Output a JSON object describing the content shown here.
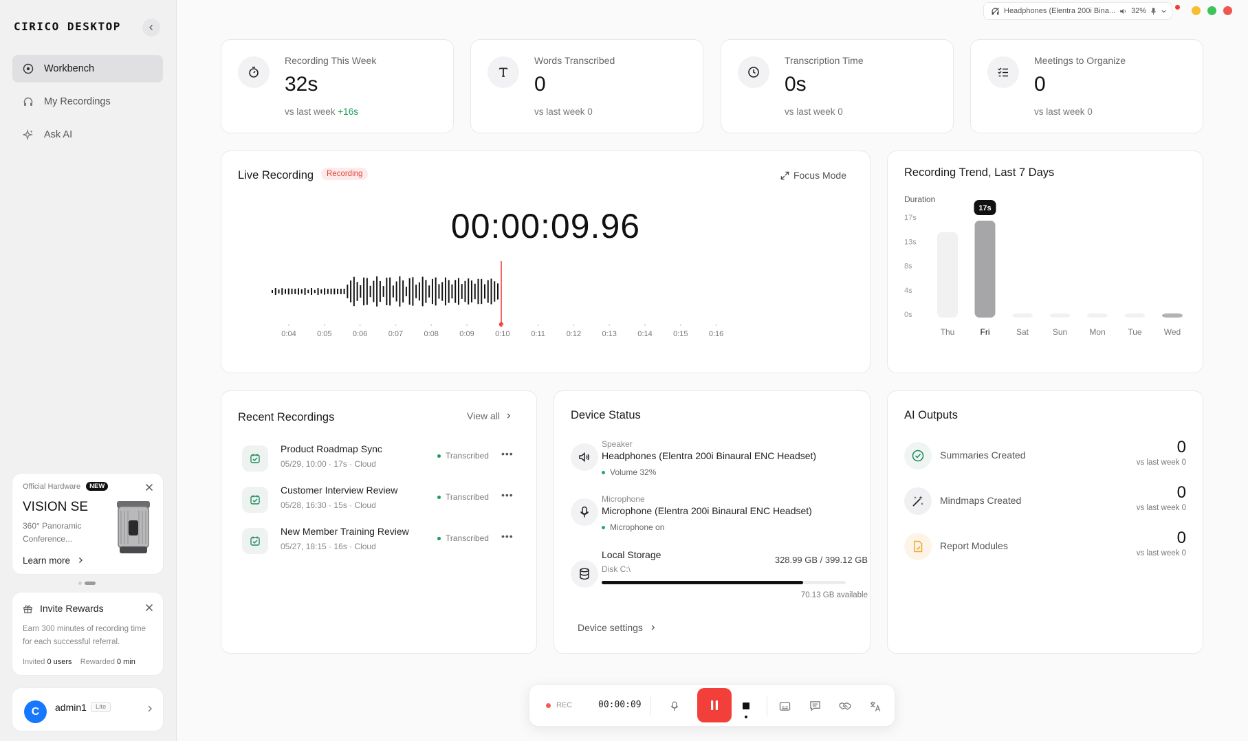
{
  "app": {
    "brand": "CIRICO DESKTOP"
  },
  "sidebar": {
    "items": [
      {
        "label": "Workbench",
        "icon": "target-icon",
        "active": true
      },
      {
        "label": "My Recordings",
        "icon": "headphones-icon",
        "active": false
      },
      {
        "label": "Ask AI",
        "icon": "sparkle-icon",
        "active": false
      }
    ],
    "promo": {
      "tag": "Official Hardware",
      "badge": "NEW",
      "title": "VISION SE",
      "desc": "360° Panoramic Conference...",
      "link": "Learn more"
    },
    "invite": {
      "title": "Invite Rewards",
      "desc": "Earn 300 minutes of recording time for each successful referral.",
      "invited_label": "Invited",
      "invited_value": "0 users",
      "rewarded_label": "Rewarded",
      "rewarded_value": "0 min"
    },
    "user": {
      "initial": "C",
      "name": "admin1",
      "plan": "Lite"
    }
  },
  "topbar": {
    "device_pill": "Headphones (Elentra 200i Bina...",
    "volume": "32%"
  },
  "stats": [
    {
      "icon": "stopwatch-icon",
      "label": "Recording This Week",
      "value": "32s",
      "sub_prefix": "vs last week",
      "sub_value": "+16s"
    },
    {
      "icon": "text-icon",
      "label": "Words Transcribed",
      "value": "0",
      "sub_prefix": "vs last week",
      "sub_value": "0"
    },
    {
      "icon": "clock-icon",
      "label": "Transcription Time",
      "value": "0s",
      "sub_prefix": "vs last week",
      "sub_value": "0"
    },
    {
      "icon": "checklist-icon",
      "label": "Meetings to Organize",
      "value": "0",
      "sub_prefix": "vs last week",
      "sub_value": "0"
    }
  ],
  "live": {
    "title": "Live Recording",
    "badge": "Recording",
    "focus": "Focus Mode",
    "timer": "00:00:09.96",
    "ticks": [
      "0:04",
      "0:05",
      "0:06",
      "0:07",
      "0:08",
      "0:09",
      "0:10",
      "0:11",
      "0:12",
      "0:13",
      "0:14",
      "0:15",
      "0:16"
    ]
  },
  "trend": {
    "title": "Recording Trend, Last 7 Days",
    "ylabel": "Duration",
    "tooltip": "17s"
  },
  "chart_data": {
    "type": "bar",
    "title": "Recording Trend, Last 7 Days",
    "ylabel": "Duration",
    "categories": [
      "Thu",
      "Fri",
      "Sat",
      "Sun",
      "Mon",
      "Tue",
      "Wed"
    ],
    "values": [
      15,
      17,
      0,
      0,
      0,
      0,
      0
    ],
    "yticks": [
      "17s",
      "13s",
      "8s",
      "4s",
      "0s"
    ],
    "ylim": [
      0,
      17
    ],
    "highlight": "Fri"
  },
  "recent": {
    "title": "Recent Recordings",
    "view_all": "View all",
    "items": [
      {
        "title": "Product Roadmap Sync",
        "meta": "05/29, 10:00 · 17s · Cloud",
        "status": "Transcribed"
      },
      {
        "title": "Customer Interview Review",
        "meta": "05/28, 16:30 · 15s · Cloud",
        "status": "Transcribed"
      },
      {
        "title": "New Member Training Review",
        "meta": "05/27, 18:15 · 16s · Cloud",
        "status": "Transcribed"
      }
    ]
  },
  "device": {
    "title": "Device Status",
    "speaker_label": "Speaker",
    "speaker_name": "Headphones (Elentra 200i Binaural ENC Headset)",
    "speaker_sub": "Volume 32%",
    "mic_label": "Microphone",
    "mic_name": "Microphone (Elentra 200i Binaural ENC Headset)",
    "mic_sub": "Microphone on",
    "storage_label": "Local Storage",
    "storage_disk": "Disk C:\\",
    "storage_used": "328.99 GB / 399.12 GB",
    "storage_available": "70.13 GB available",
    "storage_fraction": 0.824,
    "settings": "Device settings"
  },
  "ai": {
    "title": "AI Outputs",
    "items": [
      {
        "label": "Summaries Created",
        "value": "0",
        "sub": "vs last week 0",
        "icon": "check-circle-icon"
      },
      {
        "label": "Mindmaps Created",
        "value": "0",
        "sub": "vs last week 0",
        "icon": "magic-wand-icon"
      },
      {
        "label": "Report Modules",
        "value": "0",
        "sub": "vs last week 0",
        "icon": "report-icon"
      }
    ]
  },
  "recbar": {
    "rec": "REC",
    "time": "00:00:09"
  },
  "colors": {
    "accent_red": "#f23f3a",
    "green": "#1a9b57",
    "bar_highlight": "#a6a6a8"
  }
}
